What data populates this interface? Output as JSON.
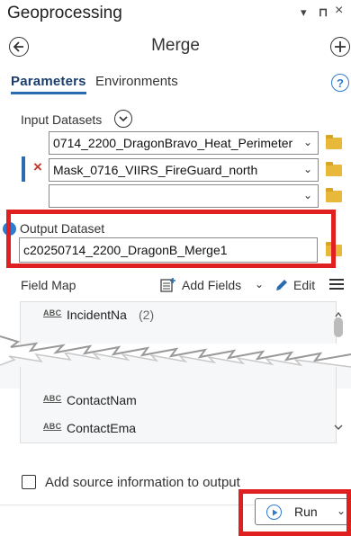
{
  "pane": {
    "title": "Geoprocessing",
    "controls": {
      "menu_glyph": "▾",
      "pin_glyph": "⊓",
      "close_glyph": "×"
    }
  },
  "tool": {
    "title": "Merge",
    "back_icon": "arrow-left-circle-icon",
    "add_icon": "plus-circle-icon"
  },
  "tabs": [
    {
      "label": "Parameters",
      "active": true
    },
    {
      "label": "Environments",
      "active": false
    }
  ],
  "help": {
    "glyph": "?"
  },
  "input_datasets": {
    "label": "Input Datasets",
    "rows": [
      {
        "value": "0714_2200_DragonBravo_Heat_Perimeter"
      },
      {
        "value": "Mask_0716_VIIRS_FireGuard_north",
        "remove_glyph": "×"
      },
      {
        "value": ""
      }
    ]
  },
  "output_dataset": {
    "label": "Output Dataset",
    "value": "c20250714_2200_DragonB_Merge1",
    "info_glyph": "i"
  },
  "field_map": {
    "label": "Field Map",
    "add_fields_label": "Add Fields",
    "edit_label": "Edit",
    "abc_badge": "ABC",
    "items": [
      {
        "name": "IncidentNa",
        "count": "(2)"
      },
      {
        "name": "ContactNam"
      },
      {
        "name": "ContactEma"
      }
    ]
  },
  "options": {
    "add_source_label": "Add source information to output",
    "checked": false
  },
  "run": {
    "label": "Run"
  },
  "colors": {
    "accent_blue": "#2b6cb0",
    "highlight_red": "#e02020",
    "folder_yellow": "#e8b83a",
    "remove_red": "#c0392b"
  }
}
